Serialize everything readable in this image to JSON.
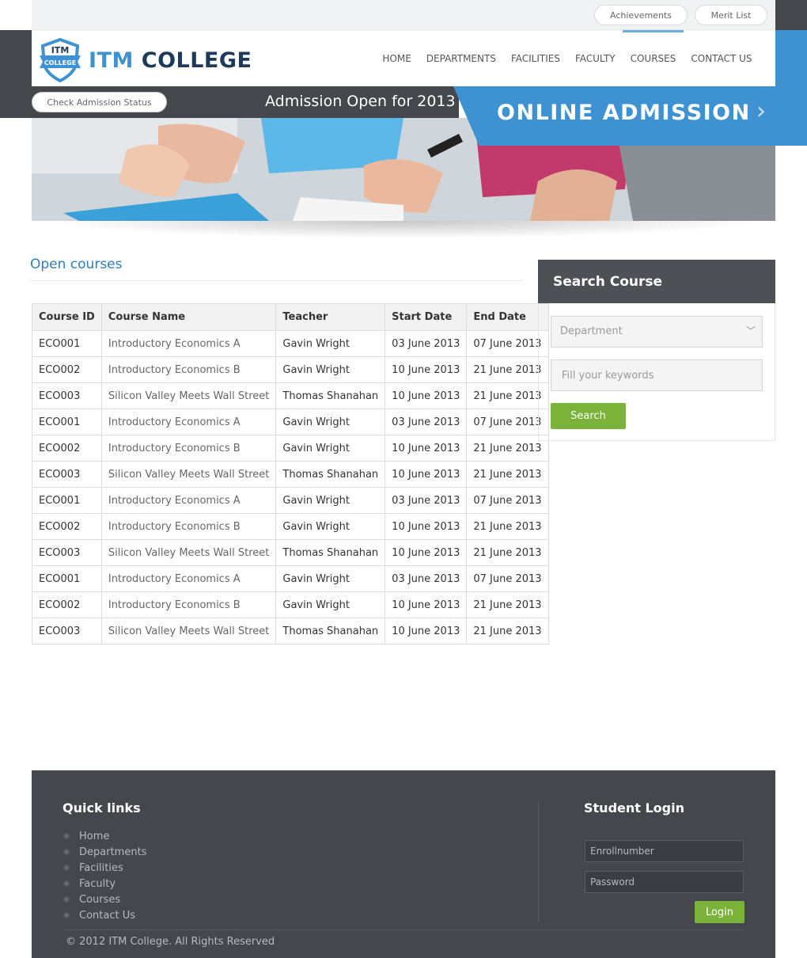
{
  "topbar": {
    "achievements": "Achievements",
    "merit_list": "Merit List"
  },
  "brand": {
    "badge_top": "ITM",
    "badge_bottom": "COLLEGE",
    "name_part1": "ITM",
    "name_part2": "COLLEGE"
  },
  "nav": {
    "items": [
      "HOME",
      "DEPARTMENTS",
      "FACILITIES",
      "FACULTY",
      "COURSES",
      "CONTACT US"
    ],
    "active": "COURSES"
  },
  "hero": {
    "status_button": "Check Admission Status",
    "headline": "Admission Open for 2013",
    "banner": "ONLINE ADMISSION"
  },
  "content": {
    "title": "Open courses",
    "table": {
      "headers": [
        "Course ID",
        "Course Name",
        "Teacher",
        "Start Date",
        "End Date"
      ],
      "rows": [
        [
          "ECO001",
          "Introductory Economics A",
          "Gavin Wright",
          "03 June 2013",
          "07 June 2013"
        ],
        [
          "ECO002",
          "Introductory Economics B",
          "Gavin Wright",
          "10 June 2013",
          "21 June 2013"
        ],
        [
          "ECO003",
          "Silicon Valley Meets Wall Street",
          "Thomas Shanahan",
          "10 June 2013",
          "21 June 2013"
        ],
        [
          "ECO001",
          "Introductory Economics A",
          "Gavin Wright",
          "03 June 2013",
          "07 June 2013"
        ],
        [
          "ECO002",
          "Introductory Economics B",
          "Gavin Wright",
          "10 June 2013",
          "21 June 2013"
        ],
        [
          "ECO003",
          "Silicon Valley Meets Wall Street",
          "Thomas Shanahan",
          "10 June 2013",
          "21 June 2013"
        ],
        [
          "ECO001",
          "Introductory Economics A",
          "Gavin Wright",
          "03 June 2013",
          "07 June 2013"
        ],
        [
          "ECO002",
          "Introductory Economics B",
          "Gavin Wright",
          "10 June 2013",
          "21 June 2013"
        ],
        [
          "ECO003",
          "Silicon Valley Meets Wall Street",
          "Thomas Shanahan",
          "10 June 2013",
          "21 June 2013"
        ],
        [
          "ECO001",
          "Introductory Economics A",
          "Gavin Wright",
          "03 June 2013",
          "07 June 2013"
        ],
        [
          "ECO002",
          "Introductory Economics B",
          "Gavin Wright",
          "10 June 2013",
          "21 June 2013"
        ],
        [
          "ECO003",
          "Silicon Valley Meets Wall Street",
          "Thomas Shanahan",
          "10 June 2013",
          "21 June 2013"
        ]
      ]
    }
  },
  "search": {
    "title": "Search Course",
    "department_placeholder": "Department",
    "keywords_placeholder": "Fill your keywords",
    "button": "Search"
  },
  "footer": {
    "quick_links_title": "Quick links",
    "quick_links": [
      "Home",
      "Departments",
      "Facilities",
      "Faculty",
      "Courses",
      "Contact Us"
    ],
    "login_title": "Student Login",
    "enroll_placeholder": "Enrollnumber",
    "password_placeholder": "Password",
    "login_button": "Login",
    "copyright": "© 2012 ITM College. All Rights Reserved"
  },
  "colors": {
    "accent_blue": "#3f92d2",
    "brand_dark": "#1d3a5a",
    "dark_gray": "#44484c",
    "green": "#7ab23a",
    "link_blue": "#2d7fb8"
  }
}
